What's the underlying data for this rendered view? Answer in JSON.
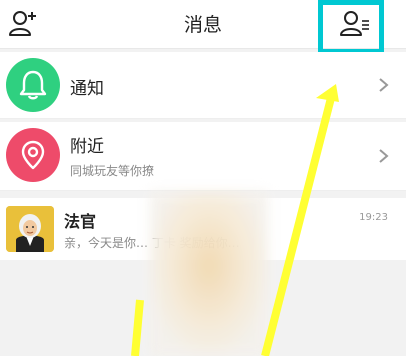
{
  "header": {
    "title": "消息",
    "left_icon": "add-friend-icon",
    "right_icon": "contacts-icon"
  },
  "items": [
    {
      "title": "通知",
      "icon": "bell-icon",
      "color": "#2fd080"
    },
    {
      "title": "附近",
      "subtitle": "同城玩友等你撩",
      "icon": "location-pin-icon",
      "color": "#ee4b6a"
    }
  ],
  "chat": {
    "name": "法官",
    "time": "19:23",
    "preview": "亲，今天是你…                        丁卡 奖励给你…"
  },
  "annotation": {
    "highlight_color": "#00c8d2",
    "arrow_color": "#ffff33"
  }
}
